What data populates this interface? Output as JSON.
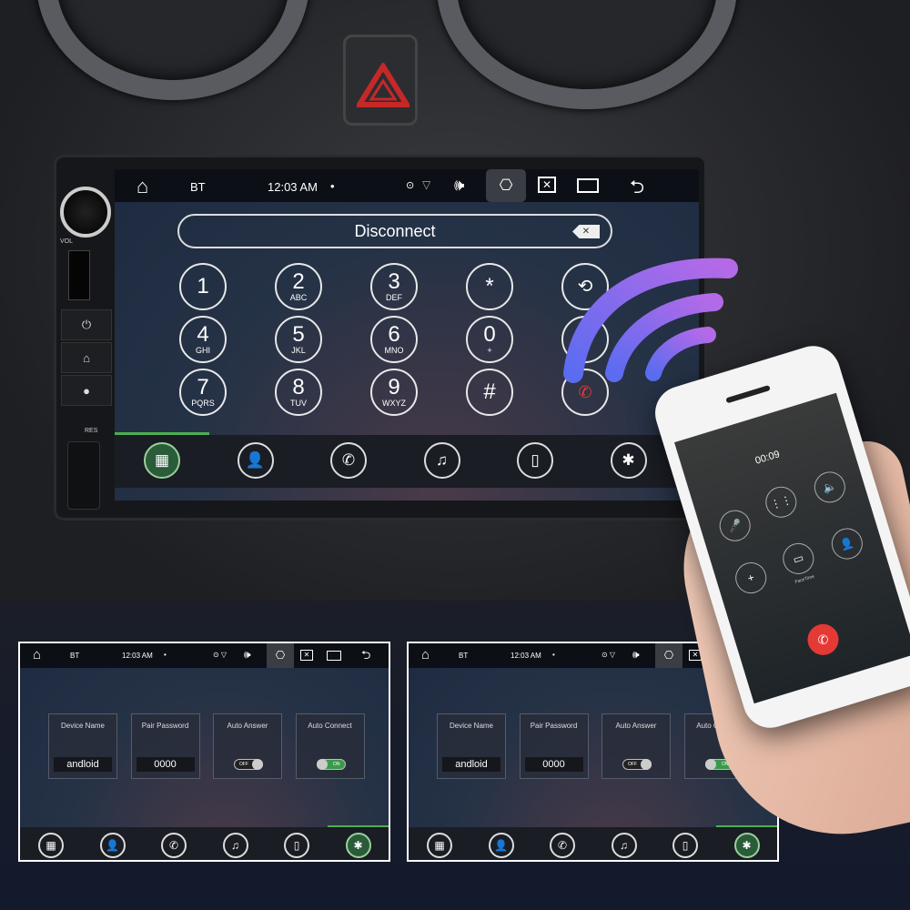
{
  "colors": {
    "accent_green": "#4caf50",
    "end_call_red": "#e53935",
    "wave_purple": "#8b5cf6",
    "hazard_red": "#c62828"
  },
  "main_screen": {
    "status": {
      "home_icon": "home-icon",
      "title": "BT",
      "time": "12:03 AM",
      "dot": "•",
      "icons": [
        "location-icon",
        "wifi-icon",
        "volume-icon",
        "screenshot-icon",
        "close-box-icon",
        "recent-apps-icon",
        "back-icon"
      ]
    },
    "number_field": {
      "value": "Disconnect",
      "clear_icon": "backspace-icon"
    },
    "keypad": [
      {
        "digit": "1",
        "letters": ""
      },
      {
        "digit": "2",
        "letters": "ABC"
      },
      {
        "digit": "3",
        "letters": "DEF"
      },
      {
        "digit": "*",
        "letters": ""
      },
      {
        "digit": "4",
        "letters": "GHI"
      },
      {
        "digit": "5",
        "letters": "JKL"
      },
      {
        "digit": "6",
        "letters": "MNO"
      },
      {
        "digit": "0",
        "letters": "+"
      },
      {
        "digit": "7",
        "letters": "PQRS"
      },
      {
        "digit": "8",
        "letters": "TUV"
      },
      {
        "digit": "9",
        "letters": "WXYZ"
      },
      {
        "digit": "#",
        "letters": ""
      }
    ],
    "side_actions": [
      "switch-audio-icon",
      "answer-call-icon",
      "end-call-icon"
    ],
    "nav": [
      "dialpad-icon",
      "contacts-icon",
      "call-log-icon",
      "music-icon",
      "bluetooth-phone-icon",
      "bluetooth-settings-icon"
    ],
    "active_nav": 0
  },
  "unit_labels": {
    "vol": "VOL",
    "res": "RES"
  },
  "settings_screens": [
    {
      "status": {
        "title": "BT",
        "time": "12:03 AM",
        "dot": "•"
      },
      "cards": [
        {
          "title": "Device Name",
          "value": "andloid"
        },
        {
          "title": "Pair Password",
          "value": "0000"
        },
        {
          "title": "Auto Answer",
          "toggle": "OFF"
        },
        {
          "title": "Auto Connect",
          "toggle": "ON"
        }
      ],
      "active_nav": 5
    },
    {
      "status": {
        "title": "BT",
        "time": "12:03 AM",
        "dot": "•"
      },
      "cards": [
        {
          "title": "Device Name",
          "value": "andloid"
        },
        {
          "title": "Pair Password",
          "value": "0000"
        },
        {
          "title": "Auto Answer",
          "toggle": "OFF"
        },
        {
          "title": "Auto Connect",
          "toggle": "ON"
        }
      ],
      "active_nav": 5
    }
  ],
  "phone": {
    "timer": "00:09",
    "facetime": "FaceTime",
    "end_call_icon": "end-call-icon"
  }
}
